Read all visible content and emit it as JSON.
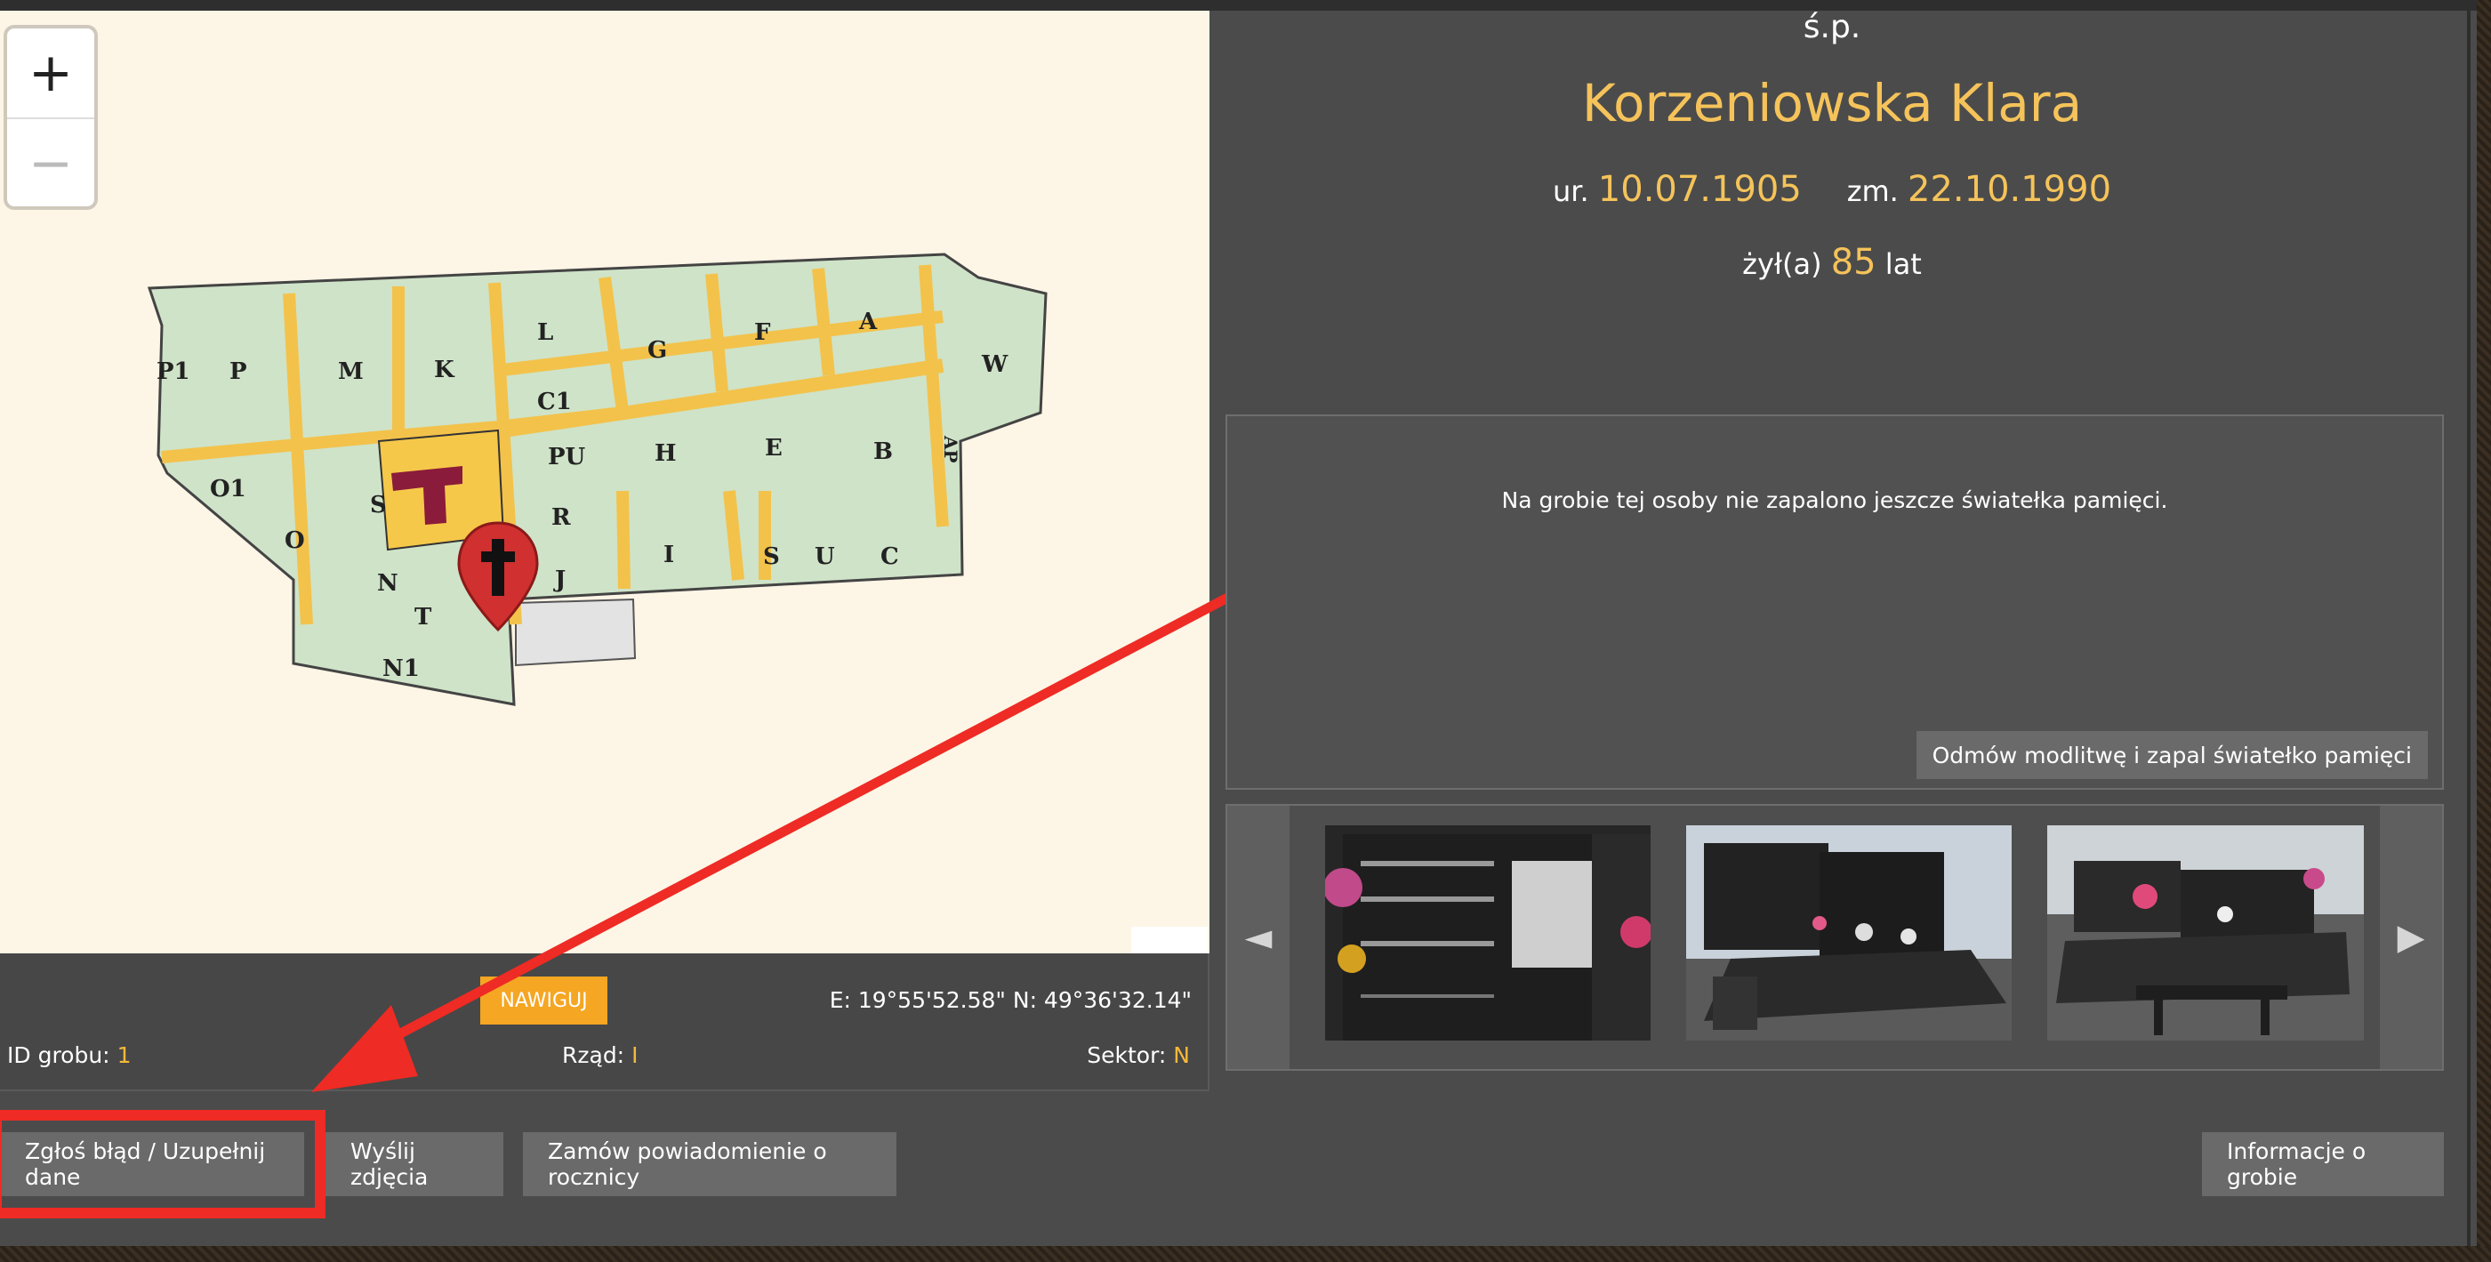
{
  "map": {
    "zoom_in": "+",
    "zoom_out": "−",
    "sectors": [
      "P1",
      "P",
      "M",
      "K",
      "L",
      "C1",
      "G",
      "F",
      "A",
      "W",
      "PU",
      "H",
      "E",
      "B",
      "AP",
      "O1",
      "S",
      "R",
      "O",
      "N",
      "J",
      "I",
      "S",
      "U",
      "C",
      "T",
      "N1"
    ]
  },
  "map_info": {
    "navigate_label": "NAWIGUJ",
    "coords": "E: 19°55'52.58\" N: 49°36'32.14\"",
    "grave_id_label": "ID grobu:",
    "grave_id": "1",
    "row_label": "Rząd:",
    "row": "I",
    "sector_label": "Sektor:",
    "sector": "N"
  },
  "buttons": {
    "report": "Zgłoś błąd / Uzupełnij dane",
    "send_photos": "Wyślij zdjęcia",
    "anniversary": "Zamów powiadomienie o rocznicy",
    "grave_info": "Informacje o grobie"
  },
  "person": {
    "prefix": "ś.p.",
    "name": "Korzeniowska Klara",
    "born_label": "ur.",
    "born": "10.07.1905",
    "died_label": "zm.",
    "died": "22.10.1990",
    "lived_label": "żył(a)",
    "age": "85",
    "age_unit": "lat"
  },
  "candle": {
    "message": "Na grobie tej osoby nie zapalono jeszcze światełka pamięci.",
    "button": "Odmów modlitwę i zapal światełko pamięci"
  },
  "gallery": {
    "prev": "◄",
    "next": "▶"
  },
  "colors": {
    "accent": "#f5c35a",
    "nav": "#f5a623",
    "highlight": "#ee2b24"
  }
}
